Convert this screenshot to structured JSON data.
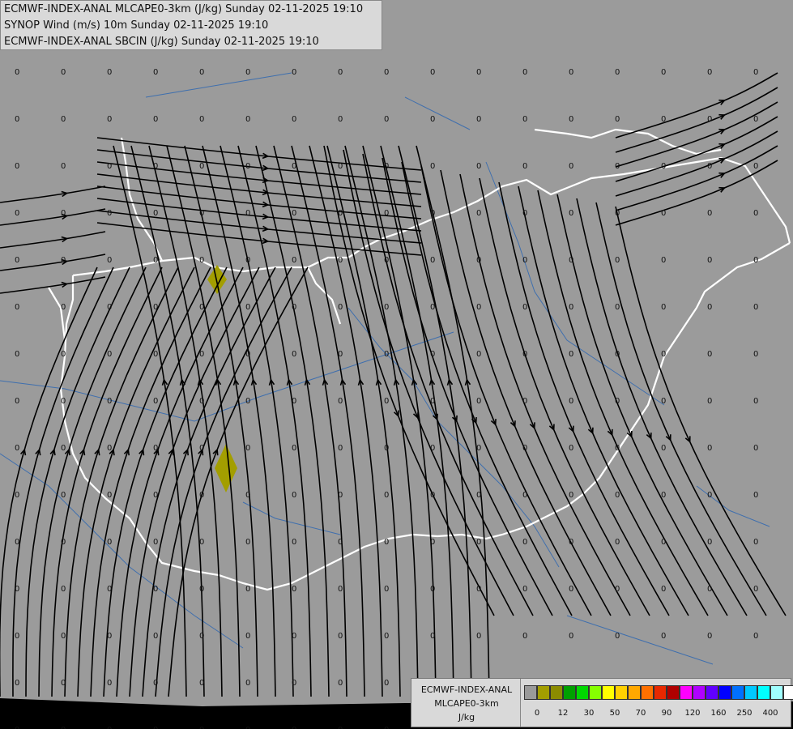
{
  "header": {
    "line1": "ECMWF-INDEX-ANAL MLCAPE0-3km (J/kg) Sunday 02-11-2025 19:10",
    "line2": "SYNOP Wind (m/s) 10m Sunday 02-11-2025 19:10",
    "line3": "ECMWF-INDEX-ANAL SBCIN (J/kg) Sunday 02-11-2025 19:10"
  },
  "legend": {
    "model": "ECMWF-INDEX-ANAL",
    "field": "MLCAPE0-3km",
    "unit": "J/kg",
    "colors": [
      "#9a9a9a",
      "#a39e00",
      "#8c8c00",
      "#00a000",
      "#00d800",
      "#86ff00",
      "#ffff00",
      "#ffd000",
      "#ffa800",
      "#ff7000",
      "#e82800",
      "#b00000",
      "#ff00ff",
      "#b000ff",
      "#6000ff",
      "#0000ff",
      "#0070ff",
      "#00c8ff",
      "#00ffff",
      "#a0ffff",
      "#ffffff"
    ],
    "ticks": [
      {
        "label": "0",
        "index": 1
      },
      {
        "label": "12",
        "index": 3
      },
      {
        "label": "30",
        "index": 5
      },
      {
        "label": "50",
        "index": 7
      },
      {
        "label": "70",
        "index": 9
      },
      {
        "label": "90",
        "index": 11
      },
      {
        "label": "120",
        "index": 13
      },
      {
        "label": "160",
        "index": 15
      },
      {
        "label": "250",
        "index": 17
      },
      {
        "label": "400",
        "index": 19
      }
    ]
  },
  "map": {
    "cin_value": "0",
    "background_color": "#9b9b9b",
    "border_color": "#ffffff",
    "river_color": "#3f6fae",
    "streamline_color": "#000000",
    "cape_color": "#a39e00"
  }
}
